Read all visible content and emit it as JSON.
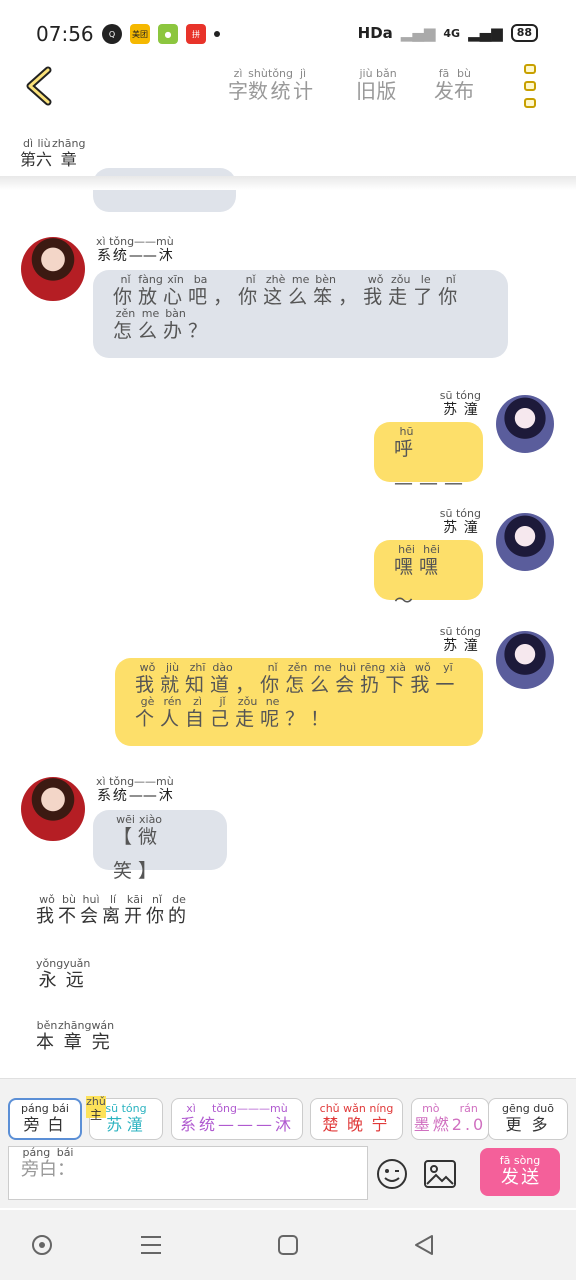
{
  "status": {
    "time": "07:56",
    "network": "HDa",
    "signal": "4G",
    "battery": "88"
  },
  "header": {
    "menu": [
      {
        "label": "字数统计",
        "pinyin": [
          "zì",
          "shù",
          "tǒng",
          "jì"
        ]
      },
      {
        "label": "旧版",
        "pinyin": [
          "jiù",
          "bǎn"
        ]
      },
      {
        "label": "发布",
        "pinyin": [
          "fā",
          "bù"
        ]
      }
    ],
    "chapter": {
      "label": "第六章",
      "pinyin": [
        "dì",
        "liù",
        "zhāng"
      ]
    }
  },
  "messages": [
    {
      "side": "left",
      "speaker": "系统——沐",
      "speaker_pinyin": "xì tǒng——mù",
      "text": "你放心吧，你这么笨，我走了你怎么办？",
      "pinyin": [
        "nǐ",
        "fàng",
        "xīn",
        "ba",
        "",
        "nǐ",
        "zhè",
        "me",
        "bèn",
        "",
        "wǒ",
        "zǒu",
        "le",
        "nǐ",
        "zěn",
        "me",
        "bàn",
        ""
      ]
    },
    {
      "side": "right",
      "speaker": "苏潼",
      "speaker_pinyin": "sū tóng",
      "text": "呼———",
      "pinyin": [
        "hū"
      ]
    },
    {
      "side": "right",
      "speaker": "苏潼",
      "speaker_pinyin": "sū tóng",
      "text": "嘿嘿～",
      "pinyin": [
        "hēi",
        "hēi"
      ]
    },
    {
      "side": "right",
      "speaker": "苏潼",
      "speaker_pinyin": "sū tóng",
      "text": "我就知道，你怎么会扔下我一个人自己走呢？！",
      "pinyin": [
        "wǒ",
        "jiù",
        "zhī",
        "dào",
        "",
        "nǐ",
        "zěn",
        "me",
        "huì",
        "rēng",
        "xià",
        "wǒ",
        "yī",
        "gè",
        "rén",
        "zì",
        "jǐ",
        "zǒu",
        "ne",
        "",
        ""
      ]
    },
    {
      "side": "left",
      "speaker": "系统——沐",
      "speaker_pinyin": "xì tǒng——mù",
      "text": "【微笑】",
      "pinyin": [
        "wēi",
        "xiào"
      ]
    }
  ],
  "narration": [
    {
      "text": "我不会离开你的",
      "pinyin": [
        "wǒ",
        "bù",
        "huì",
        "lí",
        "kāi",
        "nǐ",
        "de"
      ]
    },
    {
      "text": "永远",
      "pinyin": [
        "yǒng",
        "yuǎn"
      ]
    },
    {
      "text": "本章完",
      "pinyin": [
        "běn",
        "zhāng",
        "wán"
      ]
    }
  ],
  "roles": [
    {
      "label": "旁白",
      "pinyin": "páng bái",
      "color": "#333333"
    },
    {
      "label": "苏潼",
      "pinyin": "sū tóng",
      "badge": "主",
      "badge_pinyin": "zhǔ",
      "color": "#2bb3c0"
    },
    {
      "label": "系统———沐",
      "pinyin": "xì tǒng———mù",
      "color": "#b05ad0"
    },
    {
      "label": "楚晚宁",
      "pinyin": "chǔ wǎn níng",
      "color": "#e03a3a"
    },
    {
      "label": "墨燃2.0",
      "pinyin": "mò rán",
      "color": "#d070c0"
    },
    {
      "label": "更多",
      "pinyin": "gēng duō",
      "color": "#333333"
    }
  ],
  "input": {
    "label": "旁白：",
    "pinyin": "páng bái"
  },
  "send": {
    "label": "发送",
    "pinyin": "fā sòng"
  }
}
